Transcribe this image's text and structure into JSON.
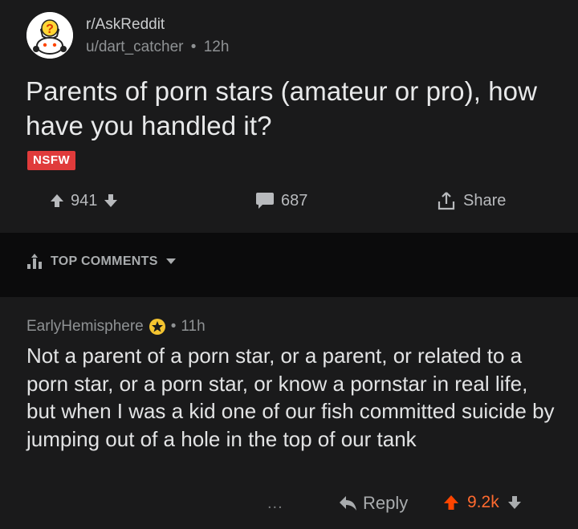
{
  "post": {
    "subreddit": "r/AskReddit",
    "author": "u/dart_catcher",
    "separator": "•",
    "age": "12h",
    "title": "Parents of porn stars (amateur or pro), how have you handled it?",
    "flair": "NSFW",
    "upvotes": "941",
    "comments": "687",
    "share_label": "Share"
  },
  "sort": {
    "label": "TOP COMMENTS"
  },
  "comment": {
    "author": "EarlyHemisphere",
    "separator": "•",
    "age": "11h",
    "body": "Not a parent of a porn star, or a parent, or related to a porn star, or a porn star, or know a pornstar in real life, but when I was a kid one of our fish committed suicide by jumping out of a hole in the top of our tank",
    "more": "...",
    "reply_label": "Reply",
    "score": "9.2k"
  },
  "colors": {
    "background": "#1a1a1b",
    "nsfw": "#e03b3b",
    "upvoted": "#ff6a2f"
  }
}
